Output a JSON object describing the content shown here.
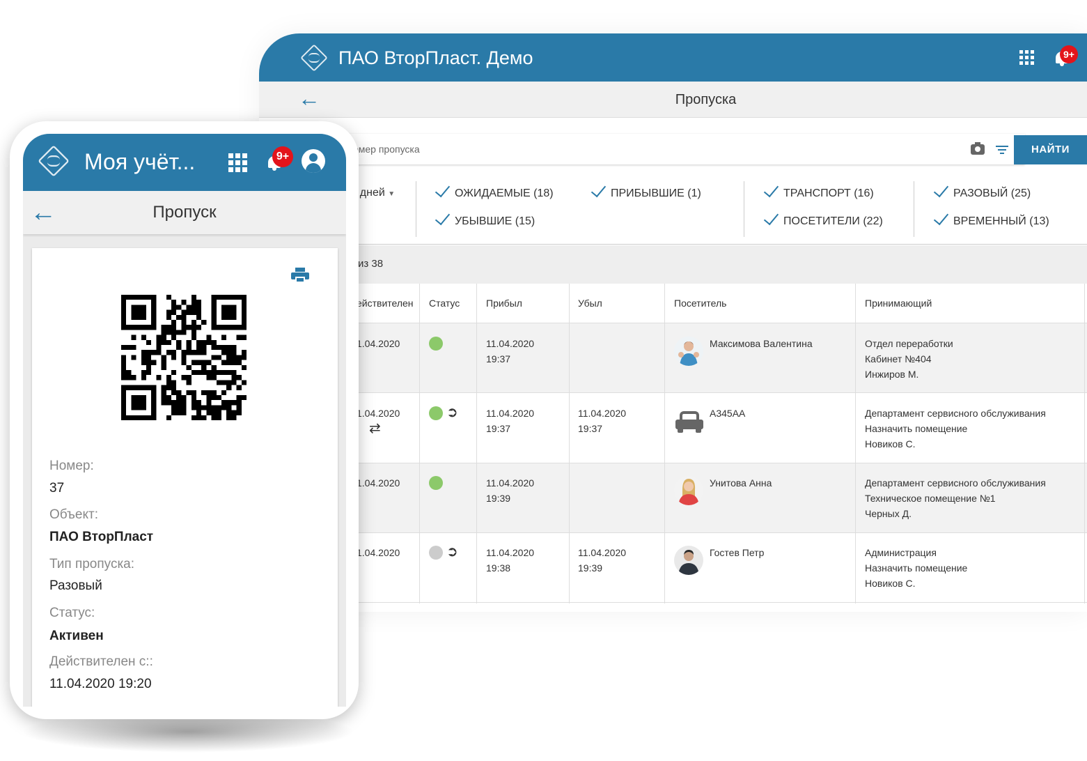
{
  "desktop": {
    "app_title": "ПАО ВторПласт. Демо",
    "notif_badge": "9+",
    "page_title": "Пропуска",
    "search_placeholder": "ль, адресат или номер пропуска",
    "find_button": "НАЙТИ",
    "days_label": ") дней",
    "filters": [
      {
        "label": "ОЖИДАЕМЫЕ (18)",
        "checked": true
      },
      {
        "label": "ПРИБЫВШИЕ (1)",
        "checked": true
      },
      {
        "label": "УБЫВШИЕ (15)",
        "checked": true
      },
      {
        "label": "ТРАНСПОРТ (16)",
        "checked": true
      },
      {
        "label": "ПОСЕТИТЕЛИ (22)",
        "checked": true
      },
      {
        "label": "РАЗОВЫЙ (25)",
        "checked": true
      },
      {
        "label": "ВРЕМЕННЫЙ (13)",
        "checked": true
      }
    ],
    "count_text": "из 38",
    "columns": [
      "ействителен",
      "Статус",
      "Прибыл",
      "Убыл",
      "Посетитель",
      "Принимающий"
    ],
    "rows": [
      {
        "valid": "1.04.2020",
        "status_color": "#8cc96a",
        "exit": false,
        "swap": false,
        "arrived_date": "11.04.2020",
        "arrived_time": "19:37",
        "left_date": "",
        "left_time": "",
        "visitor": "Максимова Валентина",
        "avatar": "woman-avatar-1",
        "host1": "Отдел переработки",
        "host2": "Кабинет №404",
        "host3": "Инжиров М."
      },
      {
        "valid": "1.04.2020",
        "status_color": "#8cc96a",
        "exit": true,
        "swap": true,
        "arrived_date": "11.04.2020",
        "arrived_time": "19:37",
        "left_date": "11.04.2020",
        "left_time": "19:37",
        "visitor": "А345АА",
        "avatar": "car-icon",
        "host1": "Департамент сервисного обслуживания",
        "host2": "Назначить помещение",
        "host3": "Новиков С."
      },
      {
        "valid": "1.04.2020",
        "status_color": "#8cc96a",
        "exit": false,
        "swap": false,
        "arrived_date": "11.04.2020",
        "arrived_time": "19:39",
        "left_date": "",
        "left_time": "",
        "visitor": "Унитова Анна",
        "avatar": "woman-avatar-2",
        "host1": "Департамент сервисного обслуживания",
        "host2": "Техническое помещение №1",
        "host3": "Черных Д."
      },
      {
        "valid": "1.04.2020",
        "status_color": "#cccccc",
        "exit": true,
        "swap": false,
        "arrived_date": "11.04.2020",
        "arrived_time": "19:38",
        "left_date": "11.04.2020",
        "left_time": "19:39",
        "visitor": "Гостев Петр",
        "avatar": "man-avatar",
        "host1": "Администрация",
        "host2": "Назначить помещение",
        "host3": "Новиков С."
      }
    ]
  },
  "phone": {
    "app_title": "Моя учёт...",
    "notif_badge": "9+",
    "page_title": "Пропуск",
    "fields": {
      "number_label": "Номер:",
      "number_value": "37",
      "object_label": "Объект:",
      "object_value": "ПАО ВторПласт",
      "type_label": "Тип пропуска:",
      "type_value": "Разовый",
      "status_label": "Статус:",
      "status_value": "Активен",
      "valid_label": "Действителен с::",
      "valid_value": "11.04.2020 19:20"
    }
  },
  "colors": {
    "primary": "#2a7aa8",
    "badge": "#e3141b",
    "status_active": "#8cc96a",
    "status_inactive": "#cccccc"
  }
}
